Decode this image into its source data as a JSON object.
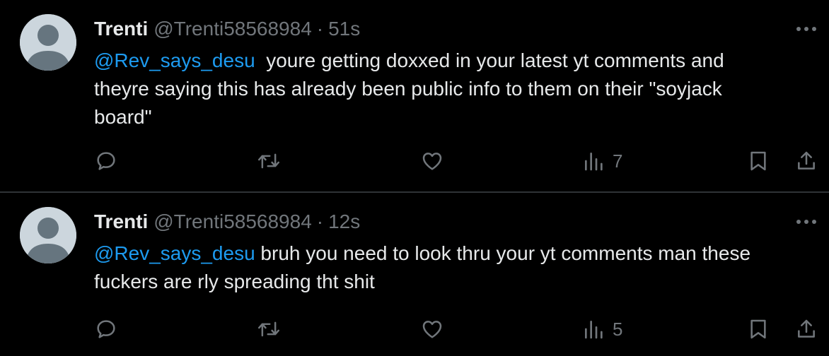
{
  "colors": {
    "background": "#000000",
    "text": "#e7e9ea",
    "secondary": "#71767b",
    "link": "#1d9bf0",
    "divider": "#2f3336"
  },
  "tweets": [
    {
      "display_name": "Trenti",
      "handle": "@Trenti58568984",
      "separator": "·",
      "time": "51s",
      "mention": "@Rev_says_desu",
      "text": "  youre getting doxxed in your latest yt comments and\ntheyre saying this has already been public info to them on their \"soyjack\nboard\"",
      "views": "7",
      "icons": [
        "reply-icon",
        "retweet-icon",
        "like-icon",
        "views-icon",
        "bookmark-icon",
        "share-icon"
      ]
    },
    {
      "display_name": "Trenti",
      "handle": "@Trenti58568984",
      "separator": "·",
      "time": "12s",
      "mention": "@Rev_says_desu",
      "text": " bruh you need to look thru your yt comments man these\nfuckers are rly spreading tht shit",
      "views": "5",
      "icons": [
        "reply-icon",
        "retweet-icon",
        "like-icon",
        "views-icon",
        "bookmark-icon",
        "share-icon"
      ]
    }
  ]
}
